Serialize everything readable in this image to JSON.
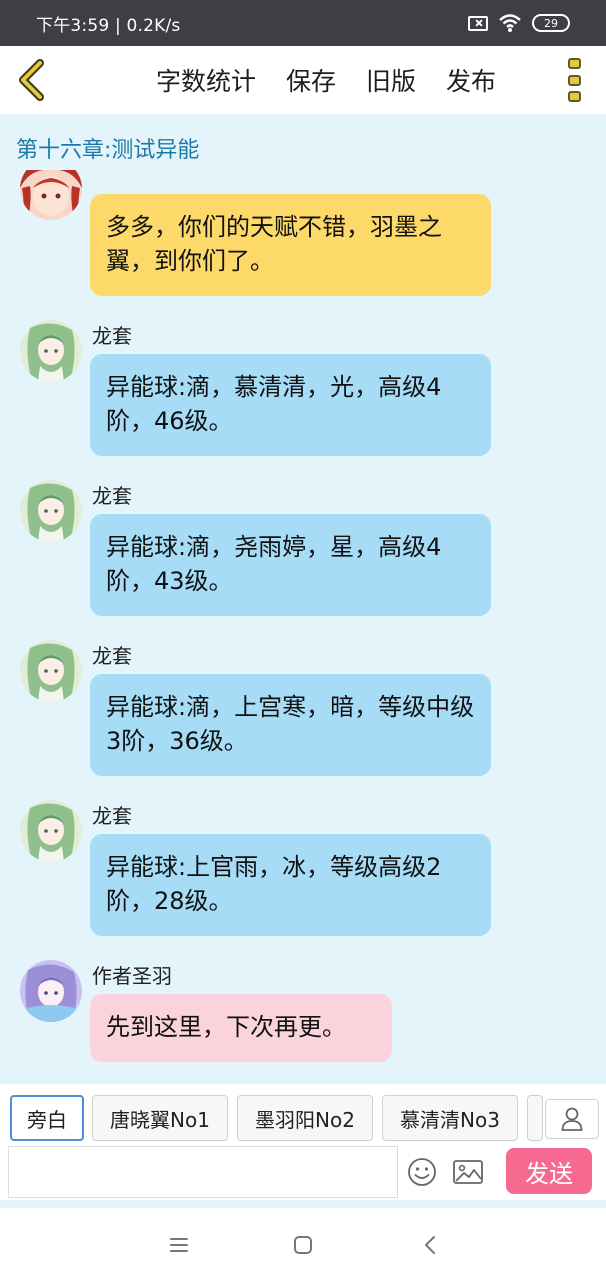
{
  "status_bar": {
    "time": "下午3:59 | 0.2K/s",
    "battery": "29"
  },
  "topbar": {
    "actions": [
      "字数统计",
      "保存",
      "旧版",
      "发布"
    ]
  },
  "chapter": {
    "title": "第十六章:测试异能"
  },
  "messages": [
    {
      "author": "",
      "text": "多多，你们的天赋不错，羽墨之翼，到你们了。",
      "color": "#fdd96a"
    },
    {
      "author": "龙套",
      "text": "异能球:滴，慕清清，光，高级4阶，46级。",
      "color": "#a7dcf7"
    },
    {
      "author": "龙套",
      "text": "异能球:滴，尧雨婷，星，高级4阶，43级。",
      "color": "#a7dcf7"
    },
    {
      "author": "龙套",
      "text": "异能球:滴，上宫寒，暗，等级中级3阶，36级。",
      "color": "#a7dcf7"
    },
    {
      "author": "龙套",
      "text": "异能球:上官雨，冰，等级高级2阶，28级。",
      "color": "#a7dcf7"
    },
    {
      "author": "作者圣羽",
      "text": "先到这里，下次再更。",
      "color": "#fbd3dc"
    }
  ],
  "role_bar": {
    "roles": [
      "旁白",
      "唐晓翼No1",
      "墨羽阳No2",
      "慕清清No3"
    ]
  },
  "input": {
    "placeholder": "",
    "send_label": "发送"
  },
  "colors": {
    "accent_blue": "#1d7aa8",
    "send_pink": "#f66a92",
    "chat_background": "#e4f4fb"
  }
}
